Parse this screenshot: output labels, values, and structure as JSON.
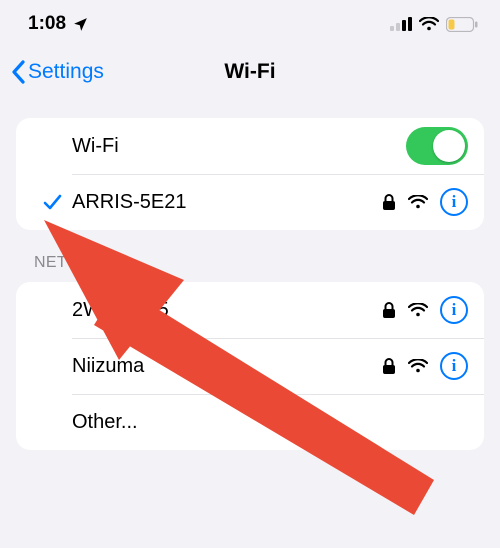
{
  "status": {
    "time": "1:08",
    "location_icon": "location-arrow",
    "battery_low": true
  },
  "nav": {
    "back_label": "Settings",
    "title": "Wi-Fi"
  },
  "main": {
    "wifi_label": "Wi-Fi",
    "wifi_on": true,
    "connected": {
      "name": "ARRIS-5E21",
      "locked": true
    }
  },
  "networks_header": "NETWORKS",
  "networks": [
    {
      "name": "2WIRE935",
      "locked": true
    },
    {
      "name": "Niizuma",
      "locked": true
    },
    {
      "name": "Other..."
    }
  ],
  "colors": {
    "tint": "#007aff",
    "toggle_on": "#34c759",
    "annotation": "#ea4a35"
  }
}
